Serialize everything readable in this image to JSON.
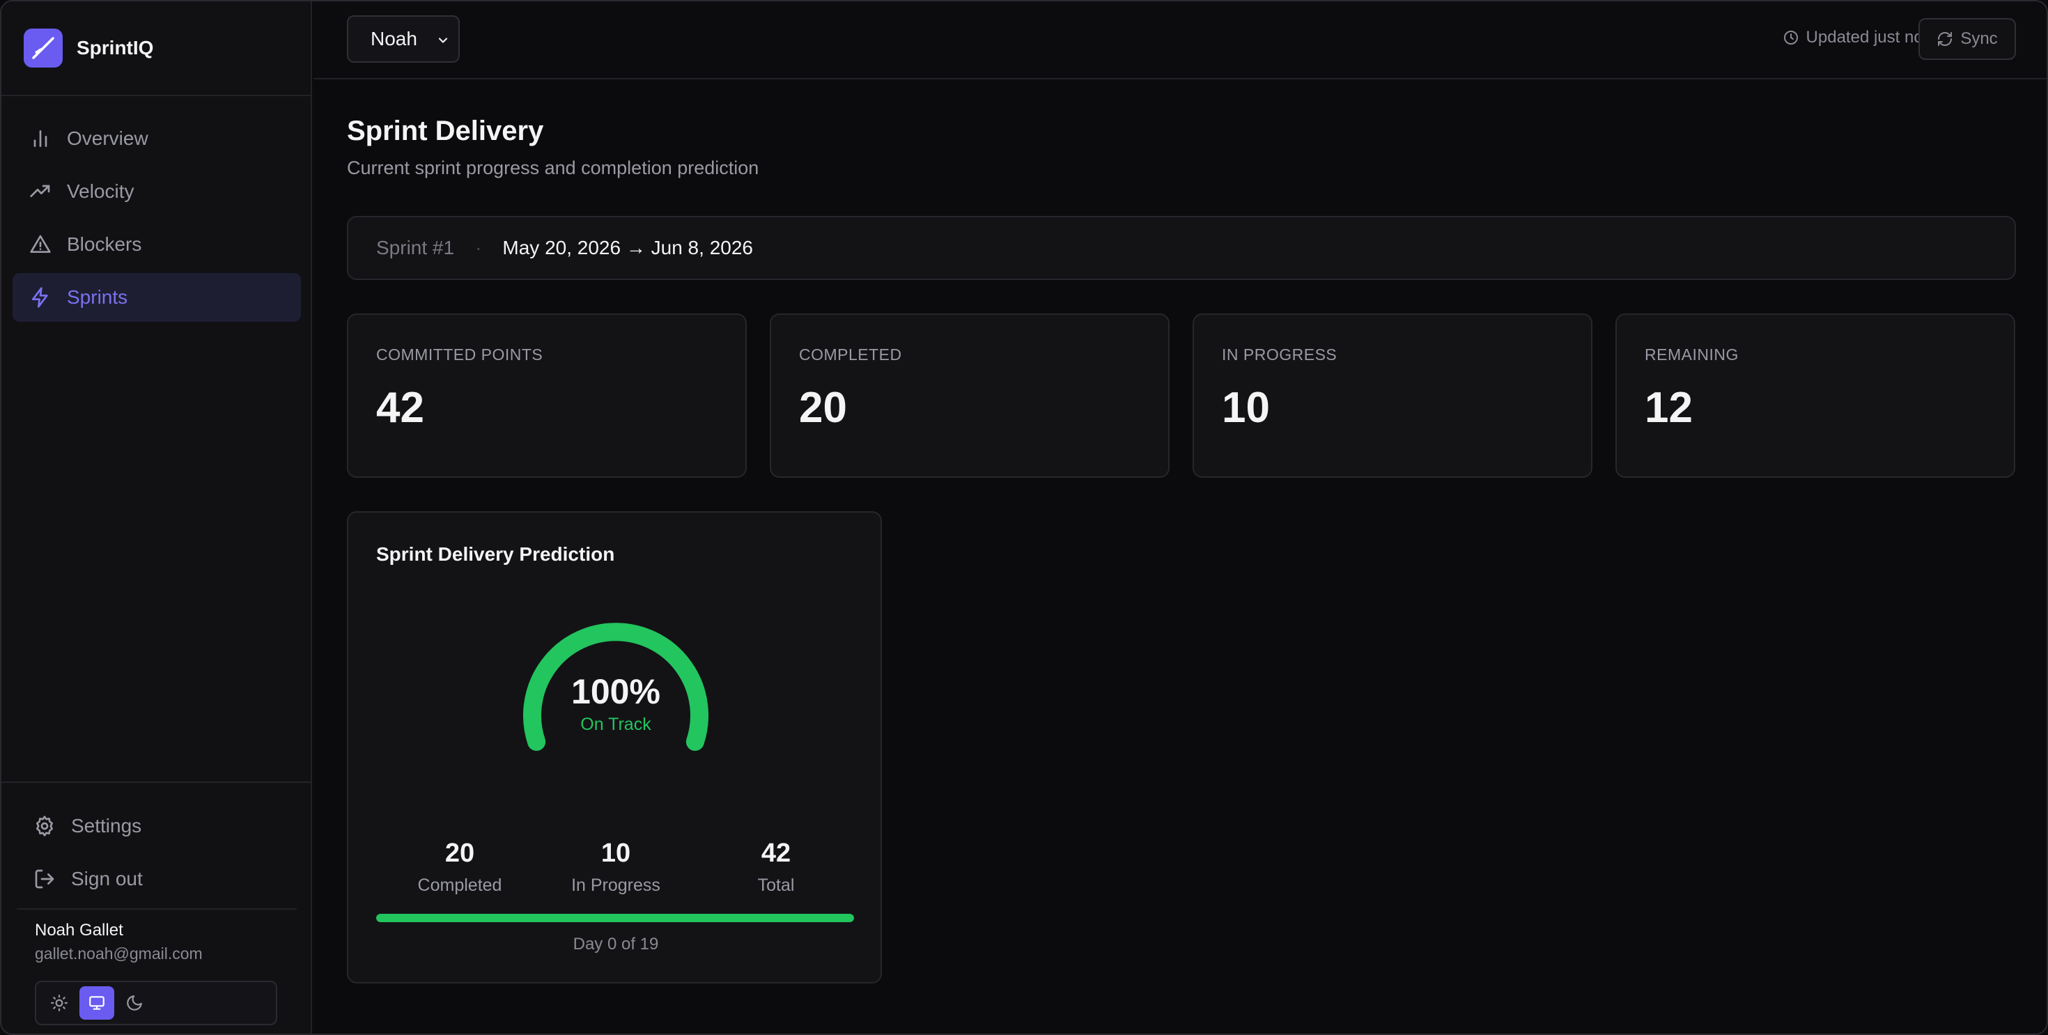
{
  "app": {
    "name": "SprintIQ"
  },
  "sidebar": {
    "items": [
      {
        "label": "Overview",
        "icon": "bar-chart-icon",
        "active": false
      },
      {
        "label": "Velocity",
        "icon": "trending-up-icon",
        "active": false
      },
      {
        "label": "Blockers",
        "icon": "alert-triangle-icon",
        "active": false
      },
      {
        "label": "Sprints",
        "icon": "zap-icon",
        "active": true
      }
    ],
    "settings_label": "Settings",
    "signout_label": "Sign out",
    "user": {
      "name": "Noah Gallet",
      "email": "gallet.noah@gmail.com"
    },
    "theme": {
      "options": [
        "light",
        "system",
        "dark"
      ],
      "selected": "system"
    }
  },
  "topbar": {
    "user_select": "Noah",
    "updated": "Updated just now",
    "sync_label": "Sync"
  },
  "page": {
    "title": "Sprint Delivery",
    "subtitle": "Current sprint progress and completion prediction"
  },
  "sprint": {
    "name": "Sprint #1",
    "separator": "·",
    "dates": "May 20, 2026 → Jun 8, 2026"
  },
  "stats": [
    {
      "label": "COMMITTED POINTS",
      "value": "42"
    },
    {
      "label": "COMPLETED",
      "value": "20"
    },
    {
      "label": "IN PROGRESS",
      "value": "10"
    },
    {
      "label": "REMAINING",
      "value": "12"
    }
  ],
  "prediction": {
    "title": "Sprint Delivery Prediction",
    "percent_text": "100%",
    "percent_value": 100,
    "status": "On Track",
    "completed": {
      "value": "20",
      "label": "Completed"
    },
    "in_progress": {
      "value": "10",
      "label": "In Progress"
    },
    "total": {
      "value": "42",
      "label": "Total"
    },
    "progress_percent": 100,
    "day_text": "Day 0 of 19",
    "gauge_color": "#22c55e"
  },
  "colors": {
    "accent": "#6a5cf0",
    "success": "#22c55e"
  }
}
